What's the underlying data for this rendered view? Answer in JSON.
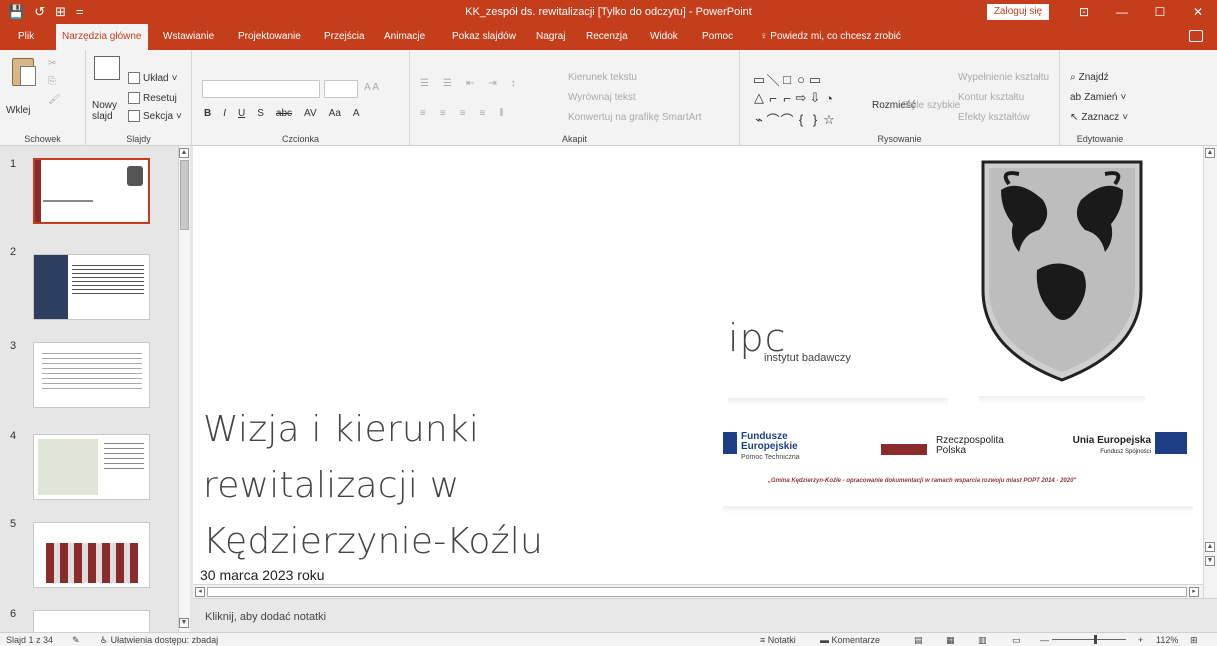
{
  "titlebar": {
    "title": "KK_zespół ds. rewitalizacji [Tylko do odczytu] - PowerPoint",
    "login": "Zaloguj się",
    "qat": [
      "💾",
      "↺",
      "⊞",
      "="
    ],
    "win": [
      "⊡",
      "—",
      "☐",
      "✕"
    ]
  },
  "tabs": {
    "items": [
      "Plik",
      "Narzędzia główne",
      "Wstawianie",
      "Projektowanie",
      "Przejścia",
      "Animacje",
      "Pokaz slajdów",
      "Nagraj",
      "Recenzja",
      "Widok",
      "Pomoc"
    ],
    "active": "Narzędzia główne",
    "tell_me": "Powiedz mi, co chcesz zrobić"
  },
  "ribbon": {
    "clipboard": {
      "label": "Schowek",
      "paste": "Wklej"
    },
    "slides": {
      "label": "Slajdy",
      "new_slide": "Nowy slajd",
      "layout": "Układ",
      "reset": "Resetuj",
      "section": "Sekcja"
    },
    "font": {
      "label": "Czcionka",
      "buttons": [
        "B",
        "I",
        "U",
        "S",
        "abc",
        "AV",
        "Aa",
        "A"
      ]
    },
    "paragraph": {
      "label": "Akapit",
      "direction": "Kierunek tekstu",
      "align": "Wyrównaj tekst",
      "smartart": "Konwertuj na grafikę SmartArt"
    },
    "drawing": {
      "label": "Rysowanie",
      "arrange": "Rozmieść",
      "quick_styles": "Style szybkie",
      "fill": "Wypełnienie kształtu",
      "outline": "Kontur kształtu",
      "effects": "Efekty kształtów"
    },
    "editing": {
      "label": "Edytowanie",
      "find": "Znajdź",
      "replace": "Zamień",
      "select": "Zaznacz"
    }
  },
  "thumbnails": [
    {
      "num": "1"
    },
    {
      "num": "2"
    },
    {
      "num": "3"
    },
    {
      "num": "4"
    },
    {
      "num": "5"
    },
    {
      "num": "6"
    }
  ],
  "slide": {
    "title_lines": [
      "Wizja i kierunki",
      "rewitalizacji w",
      "Kędzierzynie-Koźlu"
    ],
    "date": "30 marca 2023 roku",
    "ipc_word": "ipc",
    "ipc_sub": "instytut badawczy",
    "funds": {
      "eu_funds": [
        "Fundusze",
        "Europejskie",
        "Pomoc Techniczna"
      ],
      "rp": [
        "Rzeczpospolita",
        "Polska"
      ],
      "ue": [
        "Unia Europejska",
        "Fundusz Spójności"
      ],
      "caption": "„Gmina Kędzierzyn-Koźle - opracowanie dokumentacji w ramach wsparcia rozwoju miast POPT 2014 - 2020\""
    }
  },
  "notes": {
    "placeholder": "Kliknij, aby dodać notatki"
  },
  "status": {
    "slide_info": "Slajd 1 z 34",
    "accessibility": "Ułatwienia dostępu: zbadaj",
    "notes_btn": "Notatki",
    "comments_btn": "Komentarze",
    "zoom": "112%",
    "minus": "—",
    "plus": "+"
  }
}
